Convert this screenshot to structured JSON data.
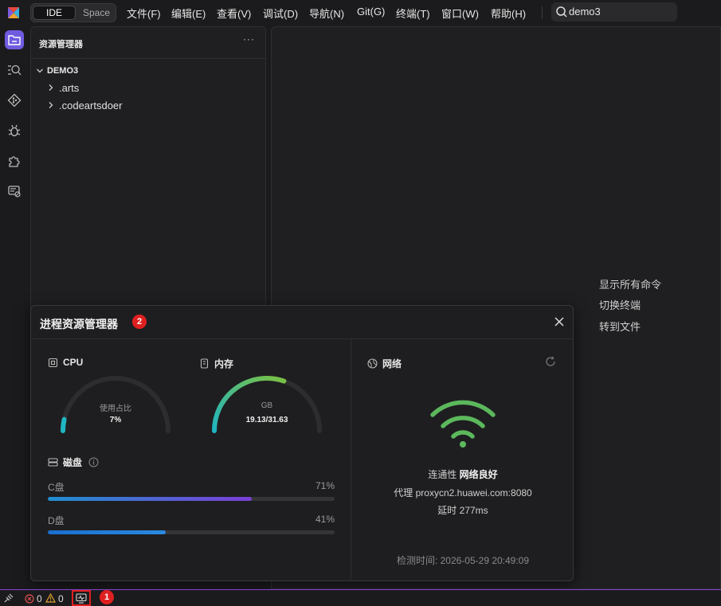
{
  "topbar": {
    "modes": [
      "IDE",
      "Space"
    ],
    "menu": [
      "文件(F)",
      "编辑(E)",
      "查看(V)",
      "调试(D)",
      "导航(N)",
      "Git(G)",
      "终端(T)",
      "窗口(W)",
      "帮助(H)"
    ],
    "search_text": "demo3"
  },
  "activity_bar": [
    "explorer-icon",
    "search-icon",
    "git-icon",
    "debug-icon",
    "extensions-icon",
    "remote-icon"
  ],
  "explorer": {
    "title": "资源管理器",
    "more": "···",
    "root": "DEMO3",
    "items": [
      ".arts",
      ".codeartsdoer"
    ]
  },
  "editor_hints": [
    "显示所有命令",
    "切换终端",
    "转到文件"
  ],
  "process_manager": {
    "title": "进程资源管理器",
    "badge": "2",
    "cpu": {
      "title": "CPU",
      "label": "使用占比",
      "value": "7%",
      "fraction": 0.07
    },
    "memory": {
      "title": "内存",
      "label": "GB",
      "value": "19.13/31.63",
      "fraction": 0.605
    },
    "disk": {
      "title": "磁盘",
      "items": [
        {
          "name": "C盘",
          "pct": "71%",
          "fraction": 0.71
        },
        {
          "name": "D盘",
          "pct": "41%",
          "fraction": 0.41
        }
      ]
    },
    "network": {
      "title": "网络",
      "connectivity_label": "连通性",
      "connectivity_value": "网络良好",
      "proxy_label": "代理",
      "proxy_value": "proxycn2.huawei.com:8080",
      "latency_label": "延时",
      "latency_value": "277ms",
      "check_time": "检测时间: 2026-05-29 20:49:09"
    }
  },
  "statusbar": {
    "errors": "0",
    "warnings": "0",
    "badge": "1"
  },
  "colors": {
    "accent": "#6f5be0",
    "gauge_teal": "#1fb5c2",
    "gauge_green": "#7bc043",
    "disk_c_start": "#1f8fd0",
    "disk_c_end": "#7b3fd6",
    "wifi": "#5cb85c",
    "badge": "#e02020"
  }
}
